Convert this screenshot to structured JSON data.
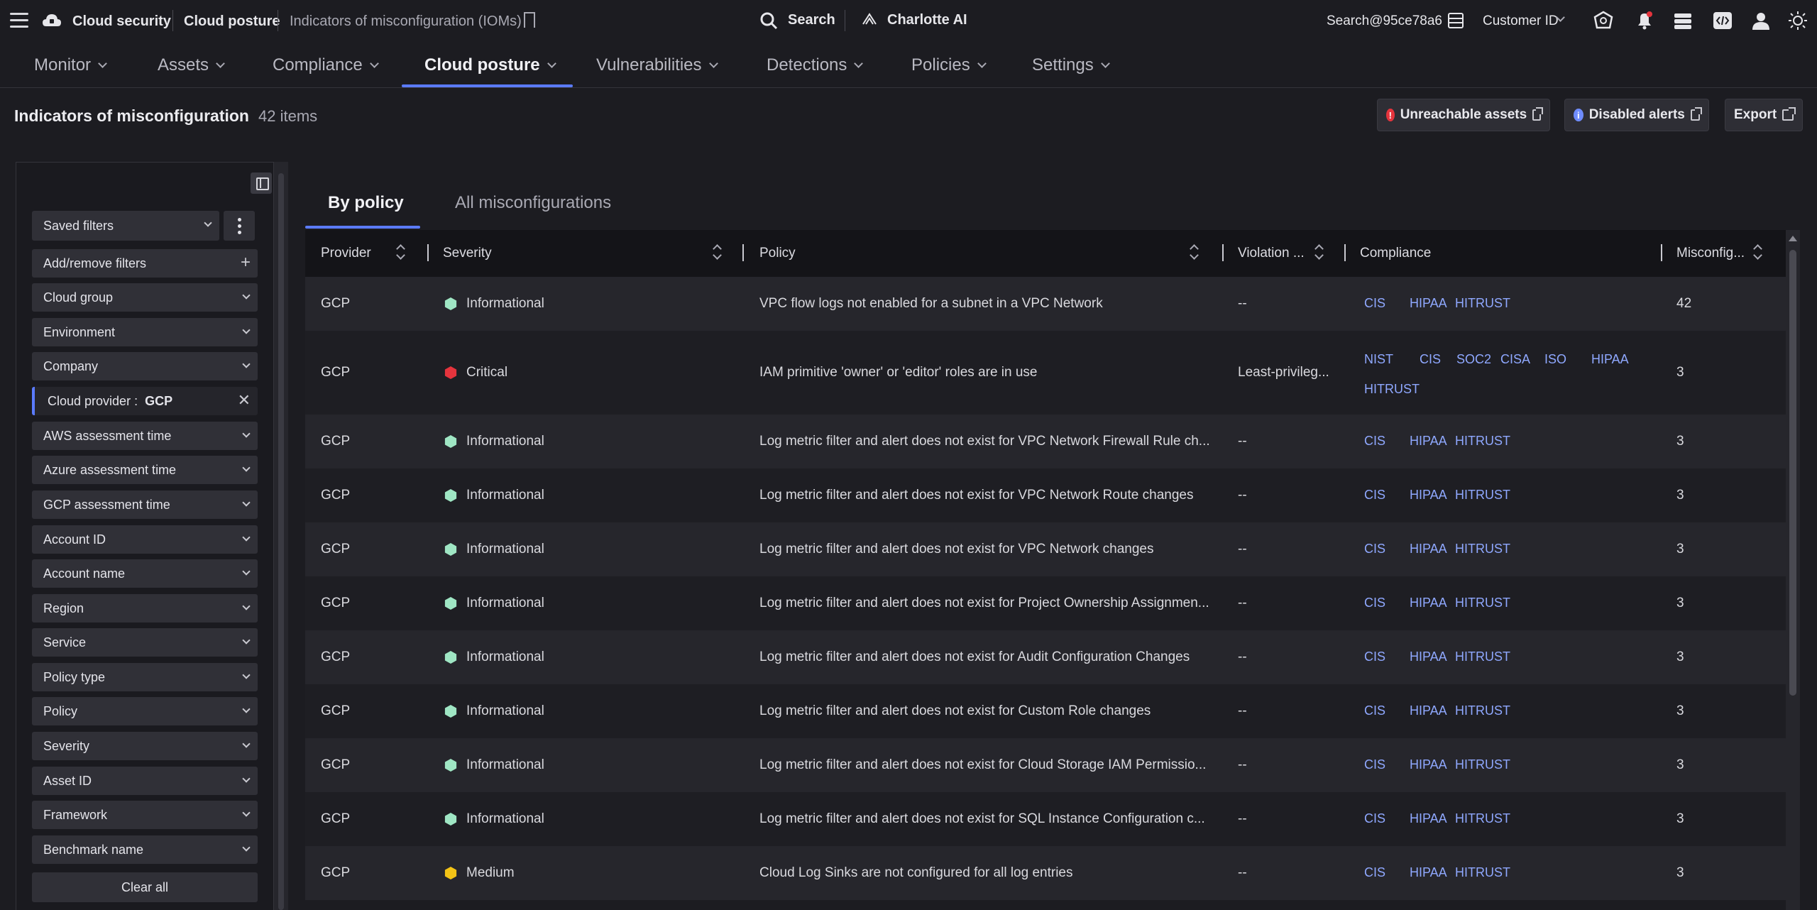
{
  "topbar": {
    "app_name": "Cloud security",
    "section": "Cloud posture",
    "page": "Indicators of misconfiguration (IOMs)",
    "search_label": "Search",
    "ai_label": "Charlotte AI",
    "user_search": "Search@95ce78a6",
    "customer_label": "Customer ID"
  },
  "nav": {
    "items": [
      {
        "label": "Monitor"
      },
      {
        "label": "Assets"
      },
      {
        "label": "Compliance"
      },
      {
        "label": "Cloud posture"
      },
      {
        "label": "Vulnerabilities"
      },
      {
        "label": "Detections"
      },
      {
        "label": "Policies"
      },
      {
        "label": "Settings"
      }
    ],
    "active": "Cloud posture"
  },
  "header": {
    "title": "Indicators of misconfiguration",
    "count": "42 items",
    "buttons": {
      "unreachable": "Unreachable assets",
      "disabled": "Disabled alerts",
      "export": "Export"
    }
  },
  "sidebar": {
    "saved_filters": "Saved filters",
    "add_remove": "Add/remove filters",
    "filters": [
      "Cloud group",
      "Environment",
      "Company",
      "AWS assessment time",
      "Azure assessment time",
      "GCP assessment time",
      "Account ID",
      "Account name",
      "Region",
      "Service",
      "Policy type",
      "Policy",
      "Severity",
      "Asset ID",
      "Framework",
      "Benchmark name"
    ],
    "active_filter": {
      "label": "Cloud provider :",
      "value": "GCP"
    },
    "clear_all": "Clear all"
  },
  "tabs": [
    {
      "label": "By policy"
    },
    {
      "label": "All misconfigurations"
    }
  ],
  "table": {
    "columns": [
      "Provider",
      "Severity",
      "Policy",
      "Violation ...",
      "Compliance",
      "Misconfig..."
    ],
    "rows": [
      {
        "provider": "GCP",
        "severity": "Informational",
        "policy": "VPC flow logs not enabled for a subnet in a VPC Network",
        "violation": "--",
        "compliance": [
          "CIS",
          "HIPAA",
          "HITRUST"
        ],
        "misconfig": "42"
      },
      {
        "provider": "GCP",
        "severity": "Critical",
        "policy": "IAM primitive 'owner' or 'editor' roles are in use",
        "violation": "Least-privileg...",
        "compliance": [
          "NIST",
          "CIS",
          "SOC2",
          "CISA",
          "ISO",
          "HIPAA",
          "HITRUST"
        ],
        "misconfig": "3"
      },
      {
        "provider": "GCP",
        "severity": "Informational",
        "policy": "Log metric filter and alert does not exist for VPC Network Firewall Rule ch...",
        "violation": "--",
        "compliance": [
          "CIS",
          "HIPAA",
          "HITRUST"
        ],
        "misconfig": "3"
      },
      {
        "provider": "GCP",
        "severity": "Informational",
        "policy": "Log metric filter and alert does not exist for VPC Network Route changes",
        "violation": "--",
        "compliance": [
          "CIS",
          "HIPAA",
          "HITRUST"
        ],
        "misconfig": "3"
      },
      {
        "provider": "GCP",
        "severity": "Informational",
        "policy": "Log metric filter and alert does not exist for VPC Network changes",
        "violation": "--",
        "compliance": [
          "CIS",
          "HIPAA",
          "HITRUST"
        ],
        "misconfig": "3"
      },
      {
        "provider": "GCP",
        "severity": "Informational",
        "policy": "Log metric filter and alert does not exist for Project Ownership Assignmen...",
        "violation": "--",
        "compliance": [
          "CIS",
          "HIPAA",
          "HITRUST"
        ],
        "misconfig": "3"
      },
      {
        "provider": "GCP",
        "severity": "Informational",
        "policy": "Log metric filter and alert does not exist for Audit Configuration Changes",
        "violation": "--",
        "compliance": [
          "CIS",
          "HIPAA",
          "HITRUST"
        ],
        "misconfig": "3"
      },
      {
        "provider": "GCP",
        "severity": "Informational",
        "policy": "Log metric filter and alert does not exist for Custom Role changes",
        "violation": "--",
        "compliance": [
          "CIS",
          "HIPAA",
          "HITRUST"
        ],
        "misconfig": "3"
      },
      {
        "provider": "GCP",
        "severity": "Informational",
        "policy": "Log metric filter and alert does not exist for Cloud Storage IAM Permissio...",
        "violation": "--",
        "compliance": [
          "CIS",
          "HIPAA",
          "HITRUST"
        ],
        "misconfig": "3"
      },
      {
        "provider": "GCP",
        "severity": "Informational",
        "policy": "Log metric filter and alert does not exist for SQL Instance Configuration c...",
        "violation": "--",
        "compliance": [
          "CIS",
          "HIPAA",
          "HITRUST"
        ],
        "misconfig": "3"
      },
      {
        "provider": "GCP",
        "severity": "Medium",
        "policy": "Cloud Log Sinks are not configured for all log entries",
        "violation": "--",
        "compliance": [
          "CIS",
          "HIPAA",
          "HITRUST"
        ],
        "misconfig": "3"
      }
    ]
  },
  "colors": {
    "accent": "#5b7bff",
    "informational": "#9fe6c4",
    "critical": "#e5343d",
    "medium": "#f3c316",
    "alert_red": "#e5343d",
    "info_blue": "#6f8cff"
  },
  "icons": [
    "menu-icon",
    "cloud-icon",
    "bookmark-icon",
    "search-icon",
    "charlotte-ai-icon",
    "grid-icon",
    "chevron-down-icon",
    "shield-icon",
    "bell-icon",
    "stack-icon",
    "code-icon",
    "user-icon",
    "sun-icon",
    "external-link-icon",
    "sort-icon",
    "close-icon",
    "plus-icon",
    "kebab-icon",
    "collapse-panel-icon"
  ]
}
